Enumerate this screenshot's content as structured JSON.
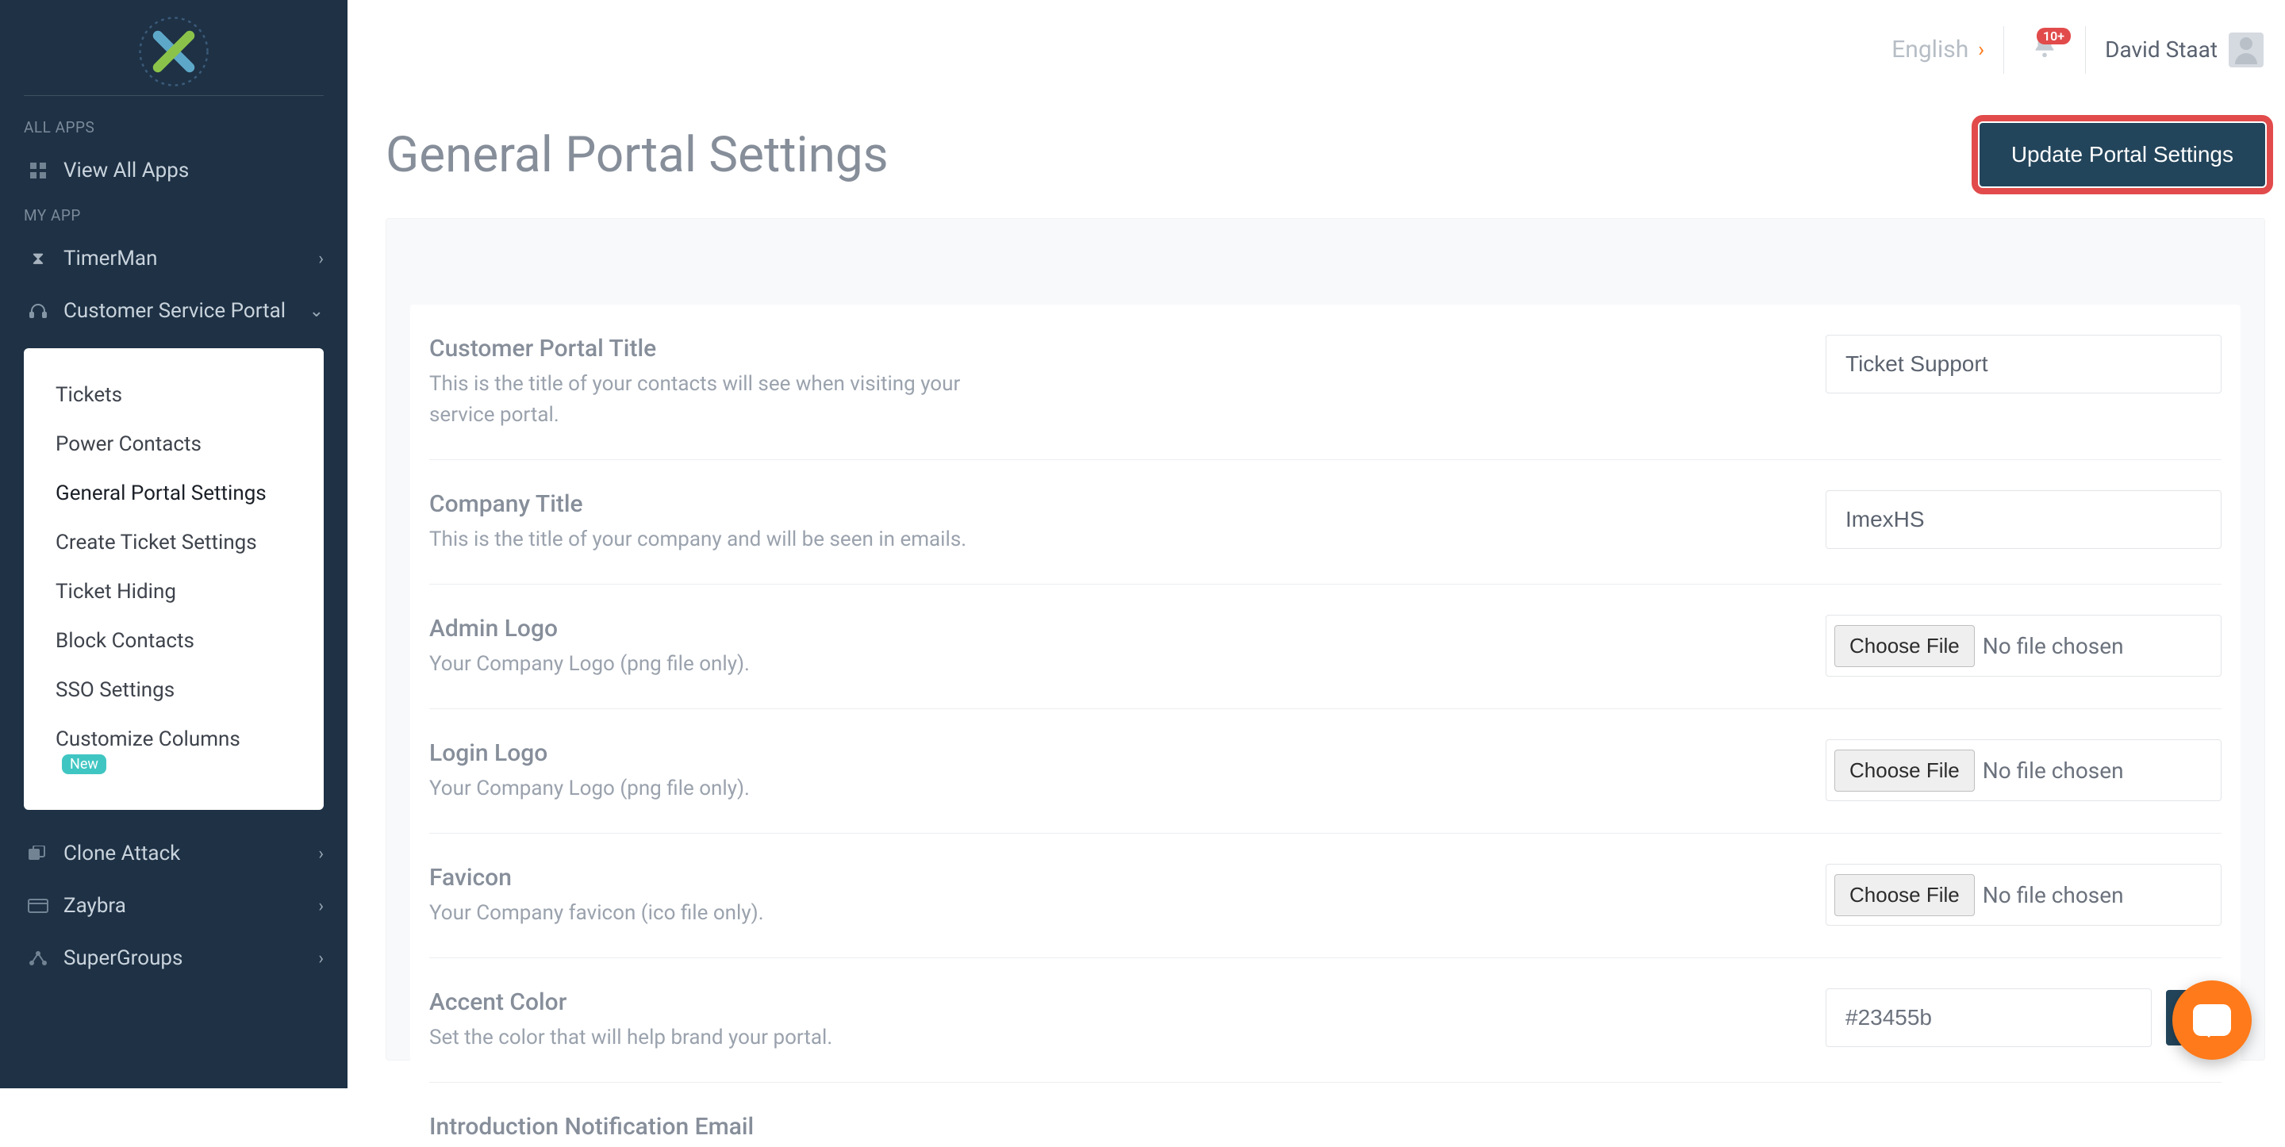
{
  "topbar": {
    "language": "English",
    "notif_badge": "10+",
    "user_name": "David Staat"
  },
  "page": {
    "title": "General Portal Settings",
    "update_button": "Update Portal Settings"
  },
  "sidebar": {
    "section_all": "ALL APPS",
    "view_all": "View All Apps",
    "section_my": "MY APP",
    "items": [
      {
        "label": "TimerMan"
      },
      {
        "label": "Customer Service Portal"
      },
      {
        "label": "Clone Attack"
      },
      {
        "label": "Zaybra"
      },
      {
        "label": "SuperGroups"
      }
    ],
    "submenu": [
      {
        "label": "Tickets"
      },
      {
        "label": "Power Contacts"
      },
      {
        "label": "General Portal Settings"
      },
      {
        "label": "Create Ticket Settings"
      },
      {
        "label": "Ticket Hiding"
      },
      {
        "label": "Block Contacts"
      },
      {
        "label": "SSO Settings"
      },
      {
        "label": "Customize Columns",
        "badge": "New"
      }
    ]
  },
  "settings": {
    "portal_title": {
      "label": "Customer Portal Title",
      "desc": "This is the title of your contacts will see when visiting your service portal.",
      "value": "Ticket Support"
    },
    "company_title": {
      "label": "Company Title",
      "desc": "This is the title of your company and will be seen in emails.",
      "value": "ImexHS"
    },
    "admin_logo": {
      "label": "Admin Logo",
      "desc": "Your Company Logo (png file only).",
      "button": "Choose File",
      "status": "No file chosen"
    },
    "login_logo": {
      "label": "Login Logo",
      "desc": "Your Company Logo (png file only).",
      "button": "Choose File",
      "status": "No file chosen"
    },
    "favicon": {
      "label": "Favicon",
      "desc": "Your Company favicon (ico file only).",
      "button": "Choose File",
      "status": "No file chosen"
    },
    "accent_color": {
      "label": "Accent Color",
      "desc": "Set the color that will help brand your portal.",
      "value": "#23455b"
    },
    "intro_email": {
      "label": "Introduction Notification Email"
    }
  }
}
